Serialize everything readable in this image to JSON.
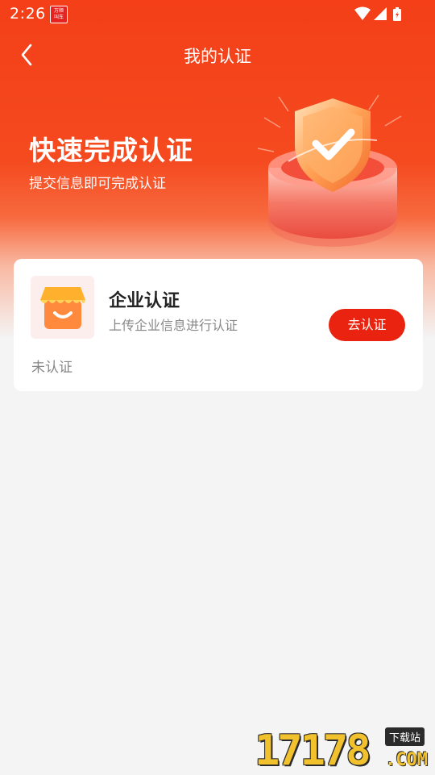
{
  "status_bar": {
    "time": "2:26",
    "app_badge_line1": "万顺",
    "app_badge_line2": "叫车",
    "icons": [
      "wifi-icon",
      "signal-icon",
      "battery-charging-icon"
    ]
  },
  "navbar": {
    "back_icon": "chevron-left-icon",
    "title": "我的认证"
  },
  "hero": {
    "title": "快速完成认证",
    "subtitle": "提交信息即可完成认证",
    "illustration": "shield-check-icon"
  },
  "card": {
    "icon": "shop-icon",
    "title": "企业认证",
    "subtitle": "上传企业信息进行认证",
    "button_label": "去认证",
    "status": "未认证"
  },
  "watermark": {
    "number": "17178",
    "tag": "下载站",
    "domain": ".COM"
  },
  "colors": {
    "primary": "#f43f18",
    "button": "#e9230f",
    "background": "#f4f4f4"
  }
}
